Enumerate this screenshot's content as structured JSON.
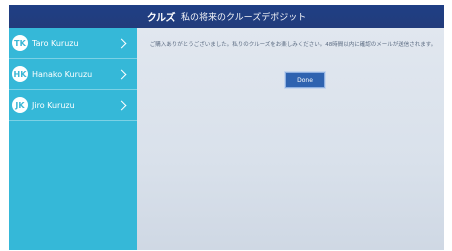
{
  "header": {
    "logo_text": "クルズ",
    "title": "私の将来のクルーズデポジット"
  },
  "sidebar": {
    "items": [
      {
        "initials": "TK",
        "name": "Taro Kuruzu"
      },
      {
        "initials": "HK",
        "name": "Hanako Kuruzu"
      },
      {
        "initials": "JK",
        "name": "Jiro Kuruzu"
      }
    ]
  },
  "main": {
    "message": "ご購入ありがとうございました。私りのクルーズをお楽しみください。48時間以内に確認のメールが送信されます。",
    "done_label": "Done"
  },
  "colors": {
    "header_bg": "#223c7b",
    "sidebar_bg": "#35b8d8",
    "button_bg": "#2f63b0"
  }
}
